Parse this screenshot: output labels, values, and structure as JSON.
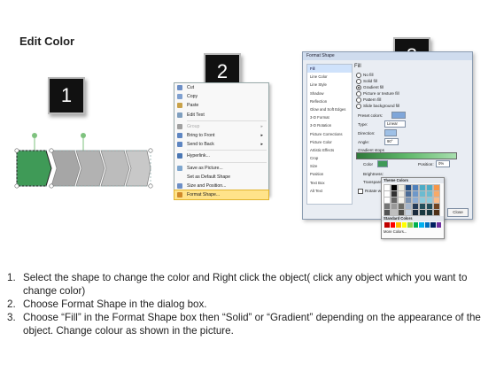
{
  "title": "Edit Color",
  "badges": [
    "1",
    "2",
    "3"
  ],
  "shape": {
    "fill_selected": "#3f9a57",
    "fill_gray": "#a6a6a6",
    "handle_color": "#7ec27e"
  },
  "context_menu": {
    "items": [
      {
        "label": "Cut",
        "icon": "scissors-icon",
        "state": "normal"
      },
      {
        "label": "Copy",
        "icon": "copy-icon",
        "state": "normal"
      },
      {
        "label": "Paste",
        "icon": "paste-icon",
        "state": "normal"
      },
      {
        "label": "Edit Text",
        "icon": "edit-text-icon",
        "state": "normal"
      },
      {
        "label": "Group",
        "icon": "group-icon",
        "state": "disabled",
        "submenu": true
      },
      {
        "label": "Bring to Front",
        "icon": "bring-front-icon",
        "state": "normal",
        "submenu": true
      },
      {
        "label": "Send to Back",
        "icon": "send-back-icon",
        "state": "normal",
        "submenu": true
      },
      {
        "label": "Hyperlink...",
        "icon": "hyperlink-icon",
        "state": "normal"
      },
      {
        "label": "Save as Picture...",
        "icon": "save-picture-icon",
        "state": "normal"
      },
      {
        "label": "Set as Default Shape",
        "icon": "",
        "state": "normal"
      },
      {
        "label": "Size and Position...",
        "icon": "size-icon",
        "state": "normal"
      },
      {
        "label": "Format Shape...",
        "icon": "format-shape-icon",
        "state": "highlighted"
      }
    ]
  },
  "dialog": {
    "title": "Format Shape",
    "side_items": [
      "Fill",
      "Line Color",
      "Line Style",
      "Shadow",
      "Reflection",
      "Glow and Soft Edges",
      "3-D Format",
      "3-D Rotation",
      "Picture Corrections",
      "Picture Color",
      "Artistic Effects",
      "Crop",
      "Size",
      "Position",
      "Text Box",
      "Alt Text"
    ],
    "section": "Fill",
    "options": [
      "No fill",
      "Solid fill",
      "Gradient fill",
      "Picture or texture fill",
      "Pattern fill",
      "Slide background fill"
    ],
    "preset_label": "Preset colors:",
    "type_label": "Type:",
    "type_value": "Linear",
    "direction_label": "Direction:",
    "angle_label": "Angle:",
    "angle_value": "90°",
    "stops_label": "Gradient stops",
    "color_label": "Color",
    "position_label": "Position:",
    "position_value": "0%",
    "brightness_label": "Brightness:",
    "transparency_label": "Transparency:",
    "rotate_label": "Rotate with shape",
    "close_label": "Close"
  },
  "color_popup": {
    "theme_label": "Theme Colors",
    "standard_label": "Standard Colors",
    "more_label": "More Colors...",
    "theme_cols": [
      "#ffffff",
      "#000000",
      "#eeece1",
      "#1f497d",
      "#4f81bd",
      "#4bacc6",
      "#4bacc6",
      "#f79646"
    ],
    "standard": [
      "#c00000",
      "#ff0000",
      "#ffc000",
      "#ffff00",
      "#92d050",
      "#00b050",
      "#00b0f0",
      "#0070c0",
      "#002060",
      "#7030a0"
    ]
  },
  "instructions": [
    {
      "num": "1.",
      "text": "Select the shape to change the color and Right click the object( click any object which you want to change color)"
    },
    {
      "num": "2.",
      "text": "Choose Format Shape in the dialog box."
    },
    {
      "num": "3.",
      "text": "Choose “Fill” in the Format Shape box then “Solid” or “Gradient” depending on the appearance of the object. Change colour as shown in the picture."
    }
  ]
}
